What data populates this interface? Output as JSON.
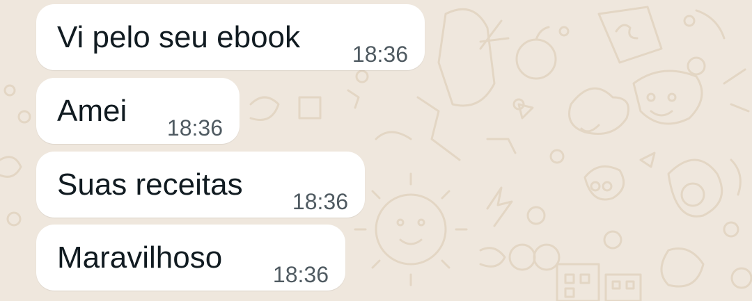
{
  "theme": {
    "wallpaper_color": "#efe7dd",
    "doodle_color": "#e3d6c4",
    "bubble_color": "#ffffff",
    "text_color": "#111b21",
    "time_color": "#4f5a61"
  },
  "messages": [
    {
      "text": "Vi pelo seu ebook",
      "time": "18:36"
    },
    {
      "text": "Amei",
      "time": "18:36"
    },
    {
      "text": "Suas receitas",
      "time": "18:36"
    },
    {
      "text": "Maravilhoso",
      "time": "18:36"
    }
  ]
}
